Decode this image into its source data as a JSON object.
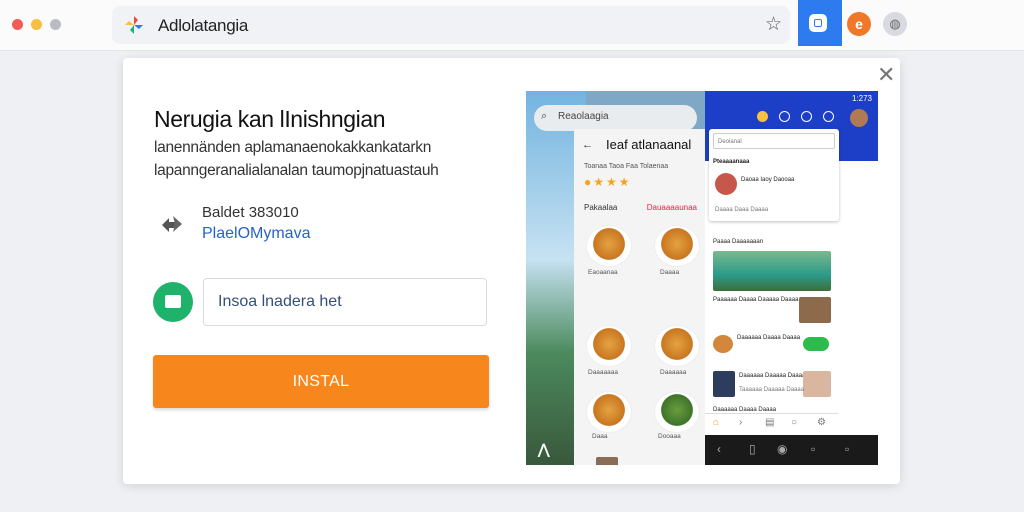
{
  "browser": {
    "tab_title": "Adlolatangia",
    "logo_icon": "app-pinwheel-icon",
    "bookmark_icon": "star-icon",
    "extension_badge": "e"
  },
  "dialog": {
    "title": "Nerugia kan lInishngian",
    "subtitle_line1": "lanennänden aplamanaenokakkankatarkn",
    "subtitle_line2": "lapanngeranalialanalan taumopjnatuastauh",
    "meta_line1": "Baldet 383010",
    "meta_link": "PlaelOMymava",
    "input_value": "Insoa lnadera het",
    "install_label": "INSTAL",
    "close_icon": "close-icon",
    "install_color": "#f7861c",
    "link_color": "#2463c9",
    "accent_green": "#1eb26b"
  },
  "preview": {
    "left": {
      "search_text": "Reaolaagia",
      "header_text": "Ieaf atlanaanal",
      "tagline": "Toanaa  Taoa  Faa  Tolaenaa",
      "section_title": "Pakaalaa",
      "section_link": "Dauaaaaunaa",
      "food_labels": [
        "Eaoaanaa",
        "Daaaa",
        "Daaaaaaa",
        "Daaaaaa",
        "Daaa",
        "Dooaaa"
      ]
    },
    "right": {
      "time": "1:273",
      "search_placeholder": "Deoianal",
      "card_title": "Pteaaaanaaa",
      "profile_name": "Daoaa Iaoy Daooaa",
      "profile_meta": "Daaaa Daaa Daaaa",
      "section2": "Paaaa Daaaaaaan",
      "list_a": "Paaaaaa Daaaa Daaaaa Daaaa",
      "list_b": "Daaaaaa Daaaa Daaaa",
      "list_c": "Daaaaaa Daaaaa Daaaa",
      "list_d": "Taaaaaa Daaaaa Daaaa",
      "list_e": "Daaaaaa Daaaa Daaaa"
    }
  }
}
